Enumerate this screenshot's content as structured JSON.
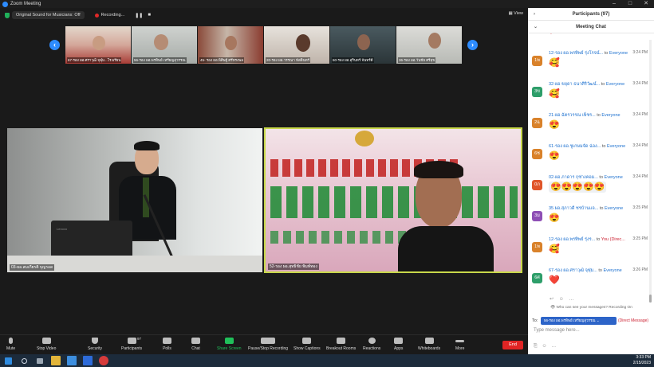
{
  "window": {
    "title": "Zoom Meeting"
  },
  "topbar": {
    "sound_label": "Original Sound for Musicians: Off",
    "recording_label": "Recording...",
    "view_label": "View"
  },
  "strip": [
    {
      "label": "67-รอง ผอ.ศราวุฒิ จุฬุม...โรงเรียน"
    },
    {
      "label": "56-รอง ผอ.พรทิพย์ เหรียญสุวรรณ"
    },
    {
      "label": "45- รอง ผอ.พิศิษฐ์ ศรีทรงพล"
    },
    {
      "label": "20-รอง ผอ.วรรณา หัสดินทร์"
    },
    {
      "label": "60-รอง ผอ.สุรินทร์ จันทร์ดี"
    },
    {
      "label": "36-รอง ผอ.วันชัย ศรีสุข"
    }
  ],
  "main_videos": [
    {
      "label": "03-ผอ.สมเกียรติ บุญรอด"
    },
    {
      "label": "52-รอง ผอ.สุทธิชัย พิมพ์ทอง"
    }
  ],
  "toolbar": {
    "mute": "Mute",
    "stop_video": "Stop Video",
    "security": "Security",
    "participants": "Participants",
    "participants_count": "97",
    "polls": "Polls",
    "chat": "Chat",
    "share_screen": "Share Screen",
    "pause_stop_recording": "Pause/Stop Recording",
    "show_captions": "Show Captions",
    "breakout_rooms": "Breakout Rooms",
    "reactions": "Reactions",
    "apps": "Apps",
    "whiteboards": "Whiteboards",
    "more": "More",
    "end": "End"
  },
  "panel": {
    "participants_header": "Participants (97)",
    "chat_header": "Meeting Chat",
    "to_label": "to",
    "everyone": "Everyone"
  },
  "messages": [
    {
      "sender": "12-รอง ผอ.พรทิพย์ รุ่งโรจน์...",
      "initials": "1พ",
      "color": "#d9822b",
      "time": "3:24 PM",
      "emoji": "🥰",
      "to": "Everyone"
    },
    {
      "sender": "32-ผอ.ขยุดา ธนาศิริวัฒน์...",
      "initials": "3ข",
      "color": "#2e9e6a",
      "time": "3:24 PM",
      "emoji": "🥰",
      "to": "Everyone"
    },
    {
      "sender": "21-ผอ.ฉัตรวรรณ เพ็ชร...",
      "initials": "2ฉ",
      "color": "#d9822b",
      "time": "3:24 PM",
      "emoji": "😍",
      "to": "Everyone"
    },
    {
      "sender": "61-รอง ผอ.ชูเกษมจัด ฉ่อง...",
      "initials": "6ช",
      "color": "#d9822b",
      "time": "3:24 PM",
      "emoji": "😍",
      "to": "Everyone"
    },
    {
      "sender": "02-ผอ.ภาดาร กุซ่างคอม...",
      "initials": "0ภ",
      "color": "#e0562b",
      "time": "3:24 PM",
      "emoji": "😍😍😍😍😍",
      "to": "Everyone"
    },
    {
      "sender": "35 ผอ.สุภาวดี ชรบ้านแจ...",
      "initials": "3ม",
      "color": "#8e4fb5",
      "time": "3:25 PM",
      "emoji": "😍",
      "to": "Everyone"
    },
    {
      "sender": "12-รอง ผอ.พรทิพย์ รุ่งร...",
      "initials": "1พ",
      "color": "#d9822b",
      "time": "3:25 PM",
      "emoji": "🥰",
      "to": "You (Direc..."
    },
    {
      "sender": "67-รอง ผอ.ศราวุฒิ จุฬุม...",
      "initials": "6ศ",
      "color": "#2e9e6a",
      "time": "3:26 PM",
      "emoji": "❤️",
      "to": "Everyone"
    }
  ],
  "chat_footer": {
    "who_can_see": "Who can see your messages? Recording On",
    "to_label": "To:",
    "recipient": "56-รอง ผอ.พรทิพย์ เหรียญสุวรรณ",
    "direct_message": "(Direct Message)",
    "placeholder": "Type message here..."
  },
  "clock": {
    "time": "3:33 PM",
    "date": "2/15/2023"
  }
}
